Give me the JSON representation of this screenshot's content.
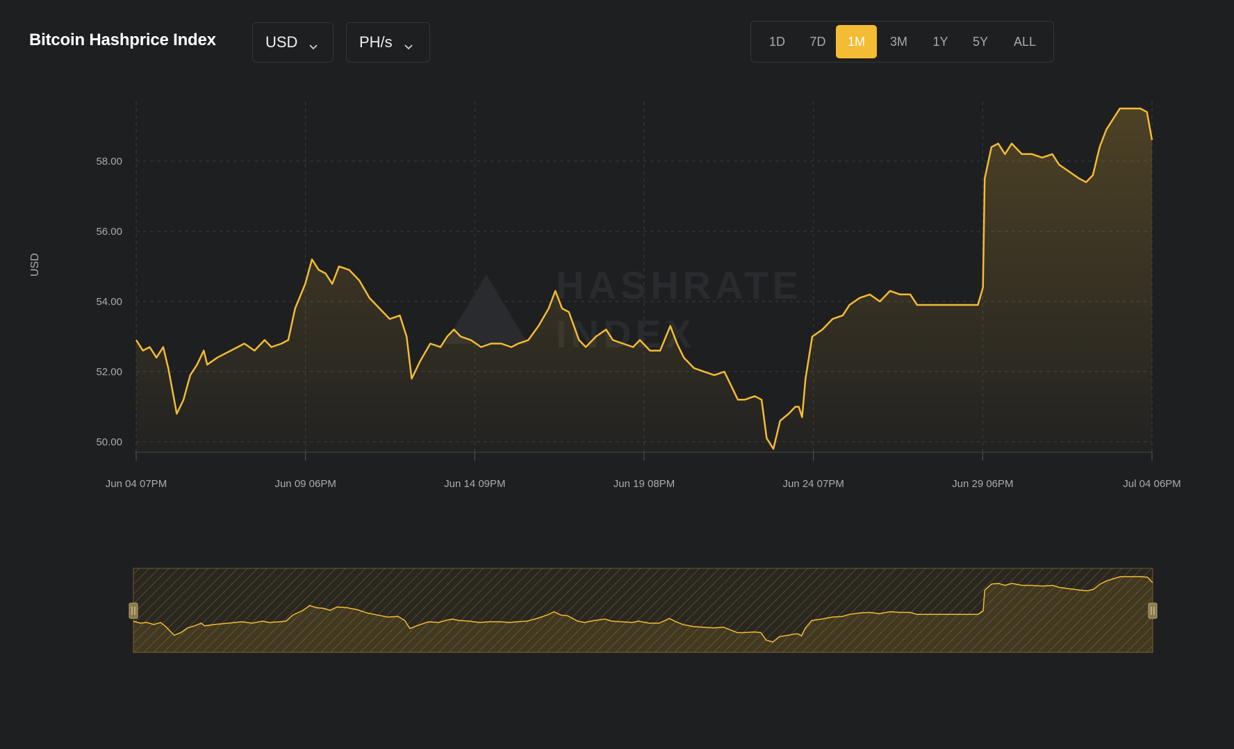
{
  "header": {
    "title": "Bitcoin Hashprice Index"
  },
  "currency_select": {
    "value": "USD"
  },
  "unit_select": {
    "value": "PH/s"
  },
  "range_buttons": [
    {
      "label": "1D",
      "active": false
    },
    {
      "label": "7D",
      "active": false
    },
    {
      "label": "1M",
      "active": true
    },
    {
      "label": "3M",
      "active": false
    },
    {
      "label": "1Y",
      "active": false
    },
    {
      "label": "5Y",
      "active": false
    },
    {
      "label": "ALL",
      "active": false
    }
  ],
  "colors": {
    "accent": "#f3bc34",
    "background": "#1e1f21",
    "grid": "#3a3c40",
    "text_muted": "#a9abaf"
  },
  "watermark": {
    "line1": "HASHRATE",
    "line2": "INDEX"
  },
  "icons": {
    "dropdown": "chevron-down-icon",
    "slider_handle": "drag-handle-icon"
  },
  "chart_data": {
    "type": "area",
    "title": "",
    "xlabel": "",
    "ylabel": "USD",
    "ylim": [
      49.7,
      59.7
    ],
    "yticks": [
      50,
      52,
      54,
      56,
      58
    ],
    "ytick_labels": [
      "50.00",
      "52.00",
      "54.00",
      "56.00",
      "58.00"
    ],
    "xtick_labels": [
      "Jun 04 07PM",
      "Jun 09 06PM",
      "Jun 14 09PM",
      "Jun 19 08PM",
      "Jun 24 07PM",
      "Jun 29 06PM",
      "Jul 04 06PM"
    ],
    "grid": true,
    "x_unit": "days since Jun 04 07PM",
    "series": [
      {
        "name": "",
        "color": "#f3bc34",
        "points": [
          [
            0.0,
            52.9
          ],
          [
            0.2,
            52.6
          ],
          [
            0.4,
            52.7
          ],
          [
            0.6,
            52.4
          ],
          [
            0.8,
            52.7
          ],
          [
            0.95,
            52.1
          ],
          [
            1.2,
            50.8
          ],
          [
            1.4,
            51.2
          ],
          [
            1.6,
            51.9
          ],
          [
            1.8,
            52.2
          ],
          [
            2.0,
            52.6
          ],
          [
            2.1,
            52.2
          ],
          [
            2.4,
            52.4
          ],
          [
            2.8,
            52.6
          ],
          [
            3.2,
            52.8
          ],
          [
            3.5,
            52.6
          ],
          [
            3.8,
            52.9
          ],
          [
            4.0,
            52.7
          ],
          [
            4.3,
            52.8
          ],
          [
            4.5,
            52.9
          ],
          [
            4.7,
            53.8
          ],
          [
            5.0,
            54.5
          ],
          [
            5.2,
            55.2
          ],
          [
            5.4,
            54.9
          ],
          [
            5.6,
            54.8
          ],
          [
            5.8,
            54.5
          ],
          [
            6.0,
            55.0
          ],
          [
            6.3,
            54.9
          ],
          [
            6.6,
            54.6
          ],
          [
            6.9,
            54.1
          ],
          [
            7.2,
            53.8
          ],
          [
            7.5,
            53.5
          ],
          [
            7.8,
            53.6
          ],
          [
            8.0,
            53.0
          ],
          [
            8.15,
            51.8
          ],
          [
            8.4,
            52.3
          ],
          [
            8.7,
            52.8
          ],
          [
            9.0,
            52.7
          ],
          [
            9.2,
            53.0
          ],
          [
            9.4,
            53.2
          ],
          [
            9.6,
            53.0
          ],
          [
            9.9,
            52.9
          ],
          [
            10.2,
            52.7
          ],
          [
            10.5,
            52.8
          ],
          [
            10.8,
            52.8
          ],
          [
            11.1,
            52.7
          ],
          [
            11.3,
            52.8
          ],
          [
            11.6,
            52.9
          ],
          [
            11.9,
            53.3
          ],
          [
            12.2,
            53.8
          ],
          [
            12.4,
            54.3
          ],
          [
            12.6,
            53.8
          ],
          [
            12.8,
            53.7
          ],
          [
            13.1,
            52.9
          ],
          [
            13.3,
            52.7
          ],
          [
            13.6,
            53.0
          ],
          [
            13.9,
            53.2
          ],
          [
            14.1,
            52.9
          ],
          [
            14.4,
            52.8
          ],
          [
            14.7,
            52.7
          ],
          [
            14.9,
            52.9
          ],
          [
            15.2,
            52.6
          ],
          [
            15.5,
            52.6
          ],
          [
            15.8,
            53.3
          ],
          [
            16.0,
            52.8
          ],
          [
            16.2,
            52.4
          ],
          [
            16.5,
            52.1
          ],
          [
            16.8,
            52.0
          ],
          [
            17.1,
            51.9
          ],
          [
            17.4,
            52.0
          ],
          [
            17.6,
            51.6
          ],
          [
            17.8,
            51.2
          ],
          [
            18.0,
            51.2
          ],
          [
            18.3,
            51.3
          ],
          [
            18.5,
            51.2
          ],
          [
            18.65,
            50.1
          ],
          [
            18.85,
            49.8
          ],
          [
            19.05,
            50.6
          ],
          [
            19.3,
            50.8
          ],
          [
            19.5,
            51.0
          ],
          [
            19.6,
            51.0
          ],
          [
            19.7,
            50.7
          ],
          [
            19.8,
            51.8
          ],
          [
            20.0,
            53.0
          ],
          [
            20.3,
            53.2
          ],
          [
            20.6,
            53.5
          ],
          [
            20.9,
            53.6
          ],
          [
            21.1,
            53.9
          ],
          [
            21.4,
            54.1
          ],
          [
            21.7,
            54.2
          ],
          [
            22.0,
            54.0
          ],
          [
            22.3,
            54.3
          ],
          [
            22.6,
            54.2
          ],
          [
            22.9,
            54.2
          ],
          [
            23.1,
            53.9
          ],
          [
            23.4,
            53.9
          ],
          [
            23.7,
            53.9
          ],
          [
            24.0,
            53.9
          ],
          [
            24.3,
            53.9
          ],
          [
            24.6,
            53.9
          ],
          [
            24.9,
            53.9
          ],
          [
            25.05,
            54.4
          ],
          [
            25.1,
            57.5
          ],
          [
            25.3,
            58.4
          ],
          [
            25.5,
            58.5
          ],
          [
            25.7,
            58.2
          ],
          [
            25.9,
            58.5
          ],
          [
            26.2,
            58.2
          ],
          [
            26.5,
            58.2
          ],
          [
            26.8,
            58.1
          ],
          [
            27.1,
            58.2
          ],
          [
            27.3,
            57.9
          ],
          [
            27.6,
            57.7
          ],
          [
            27.9,
            57.5
          ],
          [
            28.1,
            57.4
          ],
          [
            28.3,
            57.6
          ],
          [
            28.5,
            58.4
          ],
          [
            28.7,
            58.9
          ],
          [
            28.9,
            59.2
          ],
          [
            29.1,
            59.5
          ],
          [
            29.4,
            59.5
          ],
          [
            29.7,
            59.5
          ],
          [
            29.9,
            59.4
          ],
          [
            30.05,
            58.6
          ]
        ]
      }
    ]
  }
}
